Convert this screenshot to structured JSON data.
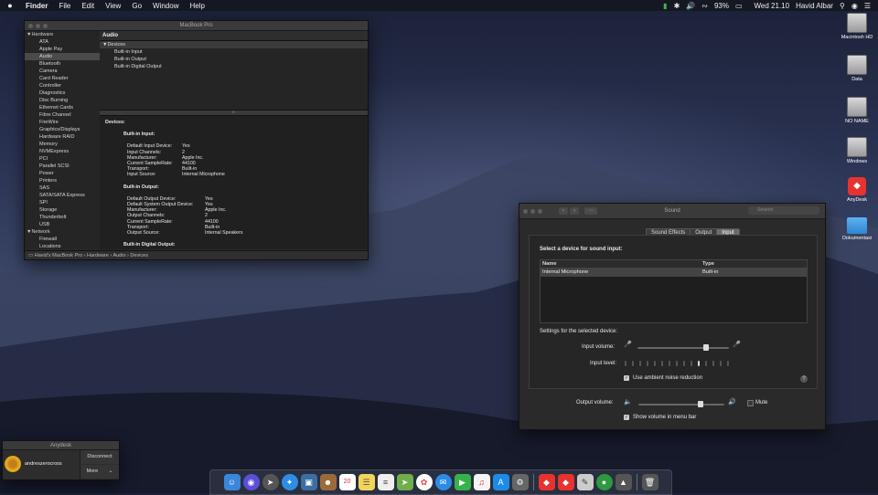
{
  "menubar": {
    "apple": "",
    "items": [
      "Finder",
      "File",
      "Edit",
      "View",
      "Go",
      "Window",
      "Help"
    ],
    "battery": "93%",
    "datetime": "Wed 21.10",
    "user": "Havid Albar"
  },
  "sysinfo": {
    "title": "MacBook Pro",
    "sidebar": [
      {
        "label": "Hardware",
        "type": "cat"
      },
      {
        "label": "ATA"
      },
      {
        "label": "Apple Pay"
      },
      {
        "label": "Audio",
        "selected": true
      },
      {
        "label": "Bluetooth"
      },
      {
        "label": "Camera"
      },
      {
        "label": "Card Reader"
      },
      {
        "label": "Controller"
      },
      {
        "label": "Diagnostics"
      },
      {
        "label": "Disc Burning"
      },
      {
        "label": "Ethernet Cards"
      },
      {
        "label": "Fibre Channel"
      },
      {
        "label": "FireWire"
      },
      {
        "label": "Graphics/Displays"
      },
      {
        "label": "Hardware RAID"
      },
      {
        "label": "Memory"
      },
      {
        "label": "NVMExpress"
      },
      {
        "label": "PCI"
      },
      {
        "label": "Parallel SCSI"
      },
      {
        "label": "Power"
      },
      {
        "label": "Printers"
      },
      {
        "label": "SAS"
      },
      {
        "label": "SATA/SATA Express"
      },
      {
        "label": "SPI"
      },
      {
        "label": "Storage"
      },
      {
        "label": "Thunderbolt"
      },
      {
        "label": "USB"
      },
      {
        "label": "Network",
        "type": "cat"
      },
      {
        "label": "Firewall"
      },
      {
        "label": "Locations"
      }
    ],
    "header": "Audio",
    "tree": {
      "devices": "Devices",
      "children": [
        "Built-in Input",
        "Built-in Output",
        "Built-in Digital Output"
      ]
    },
    "detail": {
      "heading": "Devices:",
      "input_heading": "Built-in Input:",
      "input": [
        [
          "Default Input Device:",
          "Yes"
        ],
        [
          "Input Channels:",
          "2"
        ],
        [
          "Manufacturer:",
          "Apple Inc."
        ],
        [
          "Current SampleRate:",
          "44100"
        ],
        [
          "Transport:",
          "Built-in"
        ],
        [
          "Input Source:",
          "Internal Microphone"
        ]
      ],
      "output_heading": "Built-in Output:",
      "output": [
        [
          "Default Output Device:",
          "Yes"
        ],
        [
          "Default System Output Device:",
          "Yes"
        ],
        [
          "Manufacturer:",
          "Apple Inc."
        ],
        [
          "Output Channels:",
          "2"
        ],
        [
          "Current SampleRate:",
          "44100"
        ],
        [
          "Transport:",
          "Built-in"
        ],
        [
          "Output Source:",
          "Internal Speakers"
        ]
      ],
      "digital_heading": "Built-in Digital Output:"
    },
    "path": "Havid's MacBook Pro › Hardware › Audio › Devices"
  },
  "sound": {
    "title": "Sound",
    "search_placeholder": "Search",
    "tabs": [
      "Sound Effects",
      "Output",
      "Input"
    ],
    "select_label": "Select a device for sound input:",
    "col_name": "Name",
    "col_type": "Type",
    "device_name": "Internal Microphone",
    "device_type": "Built-in",
    "settings_label": "Settings for the selected device:",
    "input_volume_label": "Input volume:",
    "input_volume": 0.75,
    "input_level_label": "Input level:",
    "input_level_active": 10,
    "ambient_label": "Use ambient noise reduction",
    "output_volume_label": "Output volume:",
    "output_volume": 0.72,
    "mute_label": "Mute",
    "show_volume_label": "Show volume in menu bar",
    "help": "?"
  },
  "anydesk": {
    "title": "Anydesk",
    "user": "andreszerocross",
    "disconnect": "Disconnect",
    "more": "More"
  },
  "desktop_icons": [
    "Macintosh HD",
    "Data",
    "NO NAME",
    "Windows",
    "AnyDesk",
    "Dokumentasi"
  ],
  "dock": {
    "calendar_day": "20"
  }
}
